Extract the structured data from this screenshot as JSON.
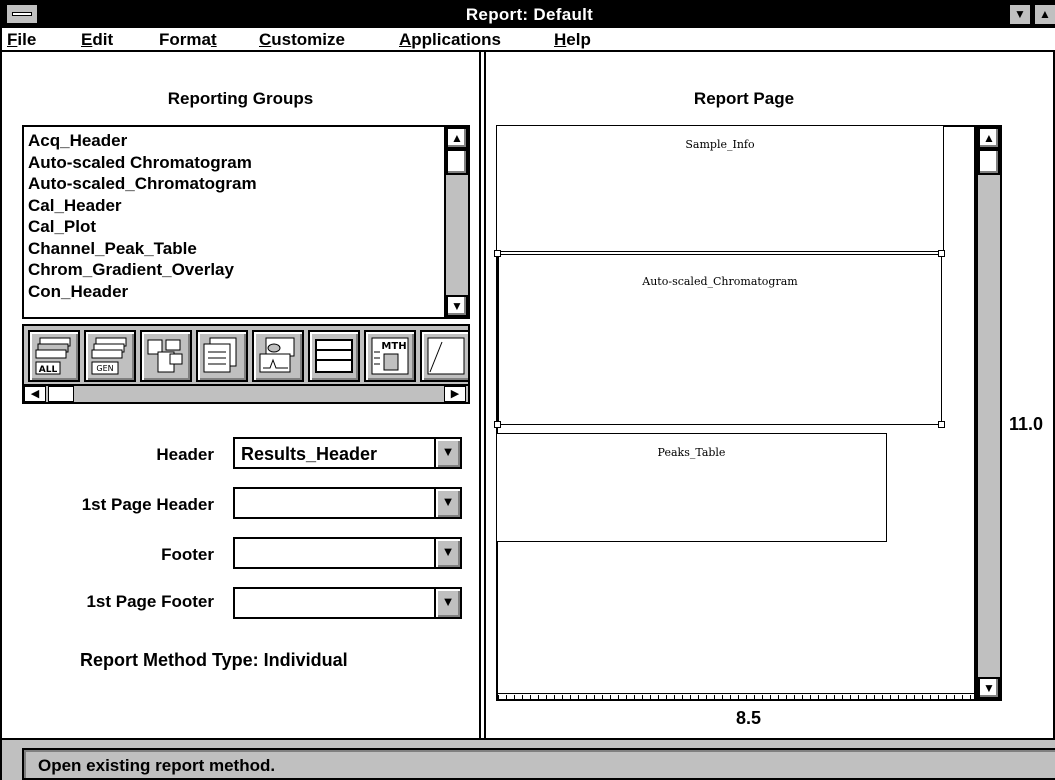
{
  "window": {
    "title": "Report: Default"
  },
  "menu": [
    {
      "mnemonic": "F",
      "rest": "ile"
    },
    {
      "mnemonic": "E",
      "rest": "dit"
    },
    {
      "pre": "Forma",
      "mnemonic": "t",
      "rest": ""
    },
    {
      "mnemonic": "C",
      "rest": "ustomize"
    },
    {
      "mnemonic": "A",
      "rest": "pplications"
    },
    {
      "mnemonic": "H",
      "rest": "elp"
    }
  ],
  "left": {
    "title": "Reporting Groups",
    "groups": [
      "Acq_Header",
      "Auto-scaled Chromatogram",
      "Auto-scaled_Chromatogram",
      "Cal_Header",
      "Cal_Plot",
      "Channel_Peak_Table",
      "Chrom_Gradient_Overlay",
      "Con_Header"
    ],
    "toolbar_icons": [
      "all-groups-icon",
      "general-groups-icon",
      "layout-groups-icon",
      "document-groups-icon",
      "plot-groups-icon",
      "table-groups-icon",
      "method-groups-icon"
    ],
    "toolbar_icon_text": {
      "all": "ALL",
      "gen": "GEN",
      "mth": "MTH"
    },
    "fields": {
      "header": {
        "label": "Header",
        "value": "Results_Header"
      },
      "first_page_header": {
        "label": "1st Page Header",
        "value": ""
      },
      "footer": {
        "label": "Footer",
        "value": ""
      },
      "first_page_footer": {
        "label": "1st Page Footer",
        "value": ""
      }
    },
    "method_type": "Report Method Type: Individual"
  },
  "right": {
    "title": "Report Page",
    "blocks": [
      "Sample_Info",
      "Auto-scaled_Chromatogram",
      "Peaks_Table"
    ],
    "page_height": "11.0",
    "page_width": "8.5"
  },
  "status": {
    "text": "Open existing report method."
  }
}
